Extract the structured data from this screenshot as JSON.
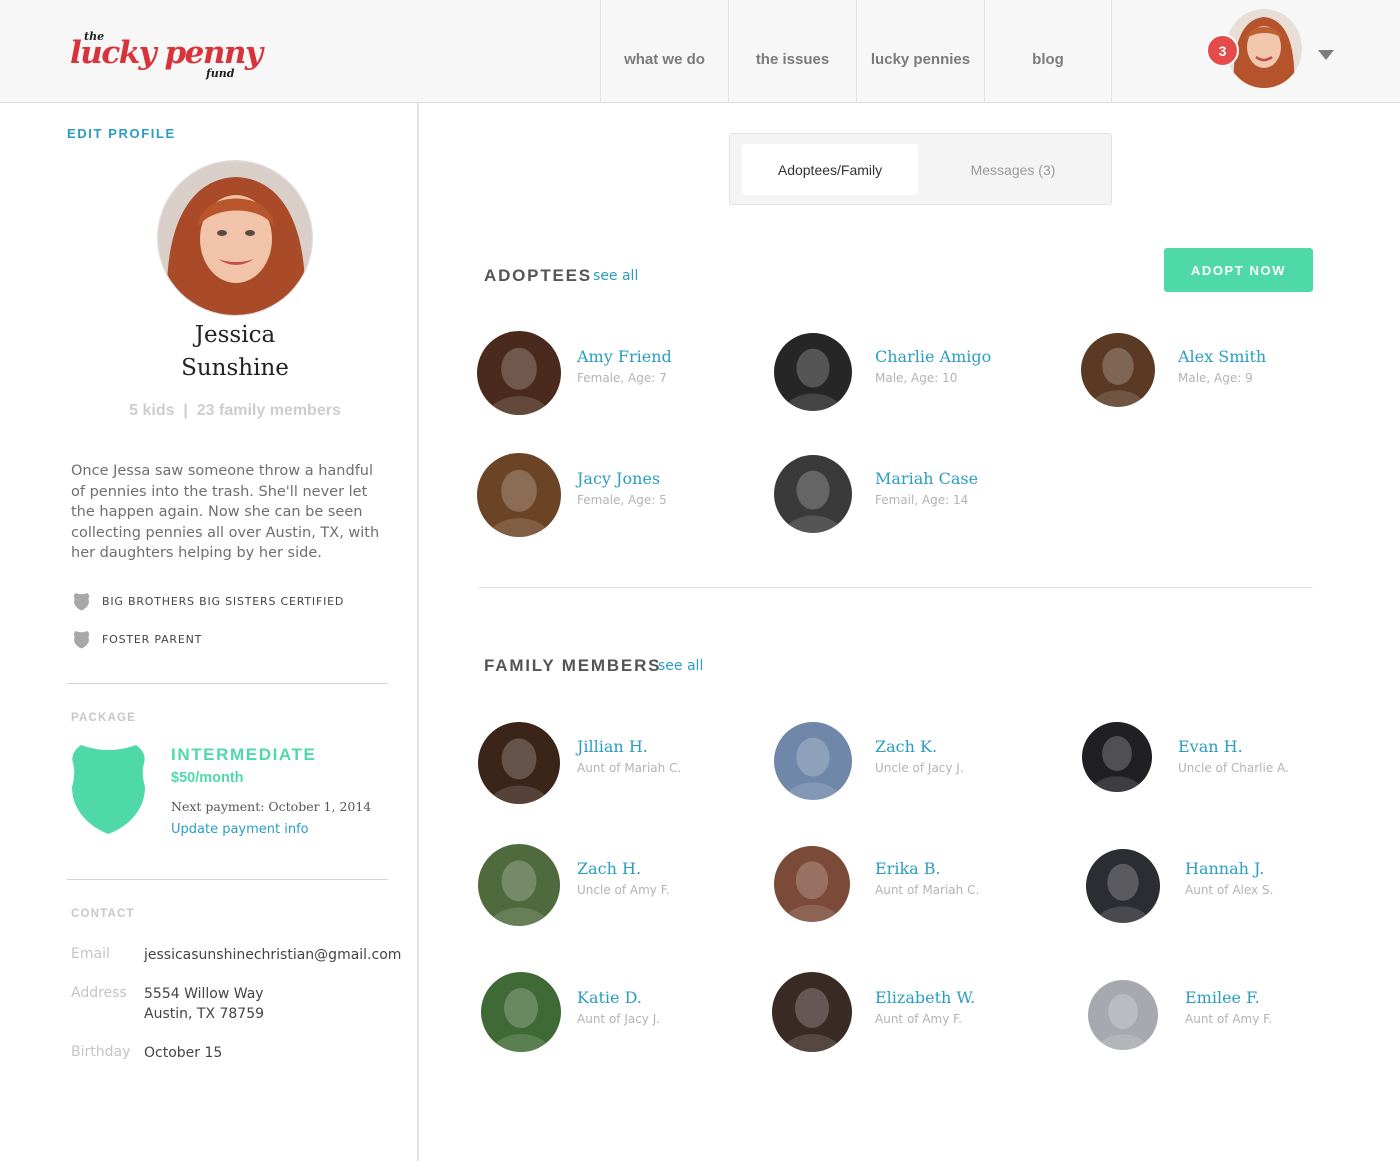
{
  "header": {
    "logo": {
      "the": "the",
      "main": "lucky penny",
      "fund": "fund"
    },
    "nav": [
      "what we do",
      "the issues",
      "lucky pennies",
      "blog"
    ],
    "notification_count": "3",
    "icons": {
      "caret": "chevron-down-icon",
      "avatar": "user-avatar"
    }
  },
  "sidebar": {
    "edit_profile": "EDIT PROFILE",
    "name_line1": "Jessica",
    "name_line2": "Sunshine",
    "stats": "5 kids  |  23 family members",
    "bio": "Once Jessa saw someone throw a handful of pennies into the trash. She'll never let the happen again. Now she can be seen collecting pennies all over Austin, TX, with her daughters helping by her side.",
    "badges": [
      "BIG BROTHERS BIG SISTERS CERTIFIED",
      "FOSTER PARENT"
    ],
    "package": {
      "label": "PACKAGE",
      "name": "INTERMEDIATE",
      "price": "$50/month",
      "next_payment": "Next payment: October 1, 2014",
      "update_link": "Update payment info"
    },
    "contact": {
      "label": "CONTACT",
      "email_label": "Email",
      "email": "jessicasunshinechristian@gmail.com",
      "address_label": "Address",
      "address_line1": "5554 Willow Way",
      "address_line2": "Austin, TX 78759",
      "birthday_label": "Birthday",
      "birthday": "October 15"
    }
  },
  "main": {
    "tabs": [
      "Adoptees/Family",
      "Messages (3)"
    ],
    "adoptees_heading": "ADOPTEES",
    "see_all": "see all",
    "adopt_button": "ADOPT NOW",
    "adoptees": [
      {
        "name": "Amy Friend",
        "info": "Female,  Age: 7",
        "color": "#4a2a1c"
      },
      {
        "name": "Charlie Amigo",
        "info": "Male,  Age: 10",
        "color": "#262626"
      },
      {
        "name": "Alex Smith",
        "info": "Male,  Age: 9",
        "color": "#5a3a24"
      },
      {
        "name": "Jacy Jones",
        "info": "Female,  Age: 5",
        "color": "#6b4426"
      },
      {
        "name": "Mariah Case",
        "info": "Femail,  Age: 14",
        "color": "#3a3a3a"
      }
    ],
    "family_heading": "FAMILY MEMBERS",
    "family": [
      {
        "name": "Jillian H.",
        "info": "Aunt of Mariah C.",
        "color": "#3b2418"
      },
      {
        "name": "Zach K.",
        "info": "Uncle of Jacy J.",
        "color": "#6f87a8"
      },
      {
        "name": "Evan H.",
        "info": "Uncle of Charlie A.",
        "color": "#1f1f24"
      },
      {
        "name": "Zach H.",
        "info": "Uncle of Amy F.",
        "color": "#4f6a3c"
      },
      {
        "name": "Erika B.",
        "info": "Aunt of Mariah C.",
        "color": "#7b4a38"
      },
      {
        "name": "Hannah J.",
        "info": "Aunt of Alex S.",
        "color": "#2c2c33"
      },
      {
        "name": "Katie D.",
        "info": "Aunt of Jacy J.",
        "color": "#3f6a35"
      },
      {
        "name": "Elizabeth W.",
        "info": "Aunt of Amy F.",
        "color": "#3a2a24"
      },
      {
        "name": "Emilee F.",
        "info": "Aunt of Amy F.",
        "color": "#a8a9b0"
      }
    ]
  },
  "colors": {
    "accent_blue": "#2a9ec2",
    "accent_green": "#4fd9a8",
    "logo_red": "#d8323a",
    "badge_red": "#e64b4b"
  }
}
